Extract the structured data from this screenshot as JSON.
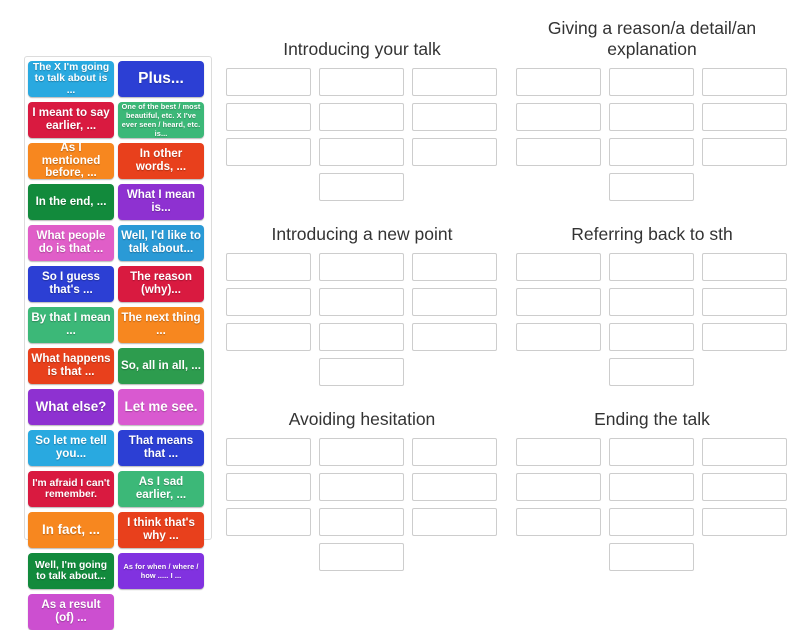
{
  "activity": {
    "type": "drag-and-drop-group-sort",
    "tray_label": "answer tiles"
  },
  "tiles": [
    {
      "text": "The X I'm going to talk about is ...",
      "color": "#29a9e0",
      "size": "fs-s"
    },
    {
      "text": "Plus...",
      "color": "#2c3fd4",
      "size": "fs-xl"
    },
    {
      "text": "I meant to say earlier, ...",
      "color": "#d91a40",
      "size": "fs-m"
    },
    {
      "text": "One of the best / most beautiful, etc. X I've ever seen / heard, etc. is...",
      "color": "#3cb878",
      "size": "fs-xs"
    },
    {
      "text": "As I mentioned before, ...",
      "color": "#f7871f",
      "size": "fs-m"
    },
    {
      "text": "In other words, ...",
      "color": "#e8401c",
      "size": "fs-m"
    },
    {
      "text": "In the end, ...",
      "color": "#128a3c",
      "size": "fs-m"
    },
    {
      "text": "What I mean is...",
      "color": "#8e31d1",
      "size": "fs-m"
    },
    {
      "text": "What people do is that ...",
      "color": "#e05ec8",
      "size": "fs-m"
    },
    {
      "text": "Well, I'd like to talk about...",
      "color": "#2a9ad6",
      "size": "fs-m"
    },
    {
      "text": "So I guess that's ...",
      "color": "#2c3fd4",
      "size": "fs-m"
    },
    {
      "text": "The reason (why)...",
      "color": "#d91a40",
      "size": "fs-m"
    },
    {
      "text": "By that I mean ...",
      "color": "#3cb878",
      "size": "fs-m"
    },
    {
      "text": "The next thing ...",
      "color": "#f7871f",
      "size": "fs-m"
    },
    {
      "text": "What happens is that ...",
      "color": "#e8401c",
      "size": "fs-m"
    },
    {
      "text": "So, all in all, ...",
      "color": "#2d9c4e",
      "size": "fs-m"
    },
    {
      "text": "What else?",
      "color": "#8e31d1",
      "size": "fs-l"
    },
    {
      "text": "Let me see.",
      "color": "#d959d0",
      "size": "fs-l"
    },
    {
      "text": "So let me tell you...",
      "color": "#29a9e0",
      "size": "fs-m"
    },
    {
      "text": "That means that ...",
      "color": "#2c3fd4",
      "size": "fs-m"
    },
    {
      "text": "I'm afraid I can't remember.",
      "color": "#d91a40",
      "size": "fs-s"
    },
    {
      "text": "As I sad earlier, ...",
      "color": "#3cb878",
      "size": "fs-m"
    },
    {
      "text": "In fact, ...",
      "color": "#f7871f",
      "size": "fs-l"
    },
    {
      "text": "I think that's why ...",
      "color": "#e8401c",
      "size": "fs-m"
    },
    {
      "text": "Well, I'm going to talk about...",
      "color": "#128a3c",
      "size": "fs-s"
    },
    {
      "text": "As for when / where / how ..... I ...",
      "color": "#8132e0",
      "size": "fs-xs"
    },
    {
      "text": "As a result (of) ...",
      "color": "#cc4fd0",
      "size": "fs-m"
    }
  ],
  "groups": [
    {
      "title": "Introducing your talk",
      "lines": 1,
      "dropzone_count": 10
    },
    {
      "title": "Giving a reason/a detail/an explanation",
      "lines": 2,
      "dropzone_count": 10
    },
    {
      "title": "Introducing a new point",
      "lines": 1,
      "dropzone_count": 10
    },
    {
      "title": "Referring back to sth",
      "lines": 1,
      "dropzone_count": 10
    },
    {
      "title": "Avoiding hesitation",
      "lines": 1,
      "dropzone_count": 10
    },
    {
      "title": "Ending the talk",
      "lines": 1,
      "dropzone_count": 10
    }
  ],
  "colors": {
    "page_background": "#ffffff",
    "tray_border": "#dcdcdc",
    "dropzone_border": "#cdcdcd",
    "title_text": "#333333",
    "tile_text": "#ffffff"
  }
}
